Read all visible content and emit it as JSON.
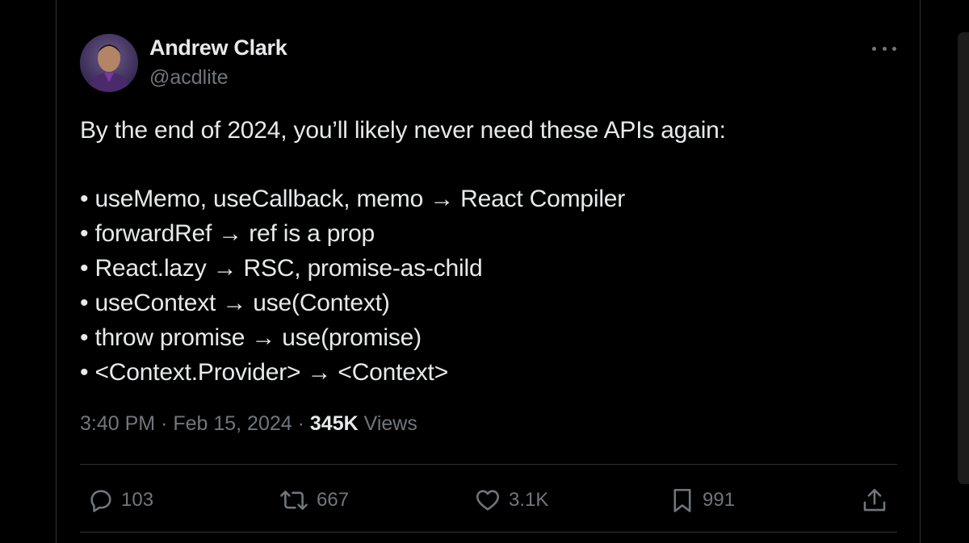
{
  "author": {
    "name": "Andrew Clark",
    "handle": "@acdlite"
  },
  "tweet": {
    "intro": "By the end of 2024, you’ll likely never need these APIs again:",
    "bullets": [
      "• useMemo, useCallback, memo → React Compiler",
      "• forwardRef → ref is a prop",
      "• React.lazy → RSC, promise-as-child",
      "• useContext → use(Context)",
      "• throw promise → use(promise)",
      "• <Context.Provider> → <Context>"
    ],
    "time": "3:40 PM",
    "separator": " · ",
    "date": "Feb 15, 2024",
    "views_count": "345K",
    "views_label": " Views"
  },
  "actions": {
    "replies": "103",
    "reposts": "667",
    "likes": "3.1K",
    "bookmarks": "991"
  },
  "icons": {
    "more": "more-icon",
    "reply": "reply-icon",
    "repost": "repost-icon",
    "like": "heart-icon",
    "bookmark": "bookmark-icon",
    "share": "share-icon"
  },
  "colors": {
    "background": "#000000",
    "text_primary": "#e7e9ea",
    "text_secondary": "#71767b",
    "border": "#2f3336"
  }
}
